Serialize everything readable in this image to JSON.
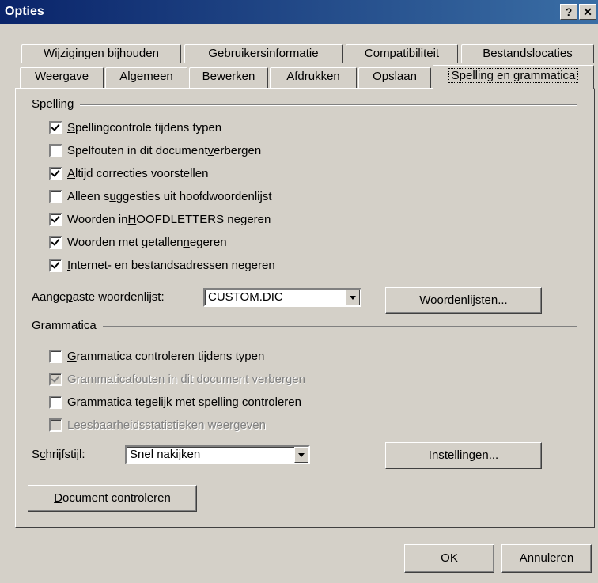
{
  "window": {
    "title": "Opties",
    "help_label": "?",
    "close_label": "✕"
  },
  "tabs_row1": [
    {
      "label": "Wijzigingen bijhouden"
    },
    {
      "label": "Gebruikersinformatie"
    },
    {
      "label": "Compatibiliteit"
    },
    {
      "label": "Bestandslocaties"
    }
  ],
  "tabs_row2": [
    {
      "label": "Weergave"
    },
    {
      "label": "Algemeen"
    },
    {
      "label": "Bewerken"
    },
    {
      "label": "Afdrukken"
    },
    {
      "label": "Opslaan"
    },
    {
      "label": "Spelling en grammatica",
      "active": true
    }
  ],
  "spelling": {
    "group_label": "Spelling",
    "options": [
      {
        "pre": "",
        "u": "S",
        "post": "pellingcontrole tijdens typen",
        "checked": true
      },
      {
        "pre": "Spelfouten in dit document ",
        "u": "v",
        "post": "erbergen",
        "checked": false
      },
      {
        "pre": "",
        "u": "A",
        "post": "ltijd correcties voorstellen",
        "checked": true
      },
      {
        "pre": "Alleen s",
        "u": "u",
        "post": "ggesties uit hoofdwoordenlijst",
        "checked": false
      },
      {
        "pre": "Woorden in ",
        "u": "H",
        "post": "OOFDLETTERS negeren",
        "checked": true
      },
      {
        "pre": "Woorden met getallen ",
        "u": "n",
        "post": "egeren",
        "checked": true
      },
      {
        "pre": "",
        "u": "I",
        "post": "nternet- en bestandsadressen negeren",
        "checked": true
      }
    ],
    "dictionary": {
      "pre": "Aange",
      "u": "p",
      "post": "aste woordenlijst:",
      "value": "CUSTOM.DIC"
    },
    "dictionaries_button": {
      "pre": "",
      "u": "W",
      "post": "oordenlijsten..."
    }
  },
  "grammar": {
    "group_label": "Grammatica",
    "options": [
      {
        "pre": "",
        "u": "G",
        "post": "rammatica controleren tijdens typen",
        "checked": false,
        "disabled": false
      },
      {
        "pre": "",
        "u": "",
        "post": "Grammaticafouten in dit document verbergen",
        "checked": true,
        "disabled": true
      },
      {
        "pre": "G",
        "u": "r",
        "post": "ammatica tegelijk met spelling controleren",
        "checked": false,
        "disabled": false
      },
      {
        "pre": "",
        "u": "",
        "post": "Leesbaarheidsstatistieken weergeven",
        "checked": false,
        "disabled": true
      }
    ],
    "style": {
      "pre": "S",
      "u": "c",
      "post": "hrijfstijl:",
      "value": "Snel nakijken"
    },
    "settings_button": {
      "pre": "Ins",
      "u": "t",
      "post": "ellingen..."
    },
    "check_doc_button": {
      "pre": "",
      "u": "D",
      "post": "ocument controleren"
    }
  },
  "footer": {
    "ok_label": "OK",
    "cancel_label": "Annuleren"
  }
}
